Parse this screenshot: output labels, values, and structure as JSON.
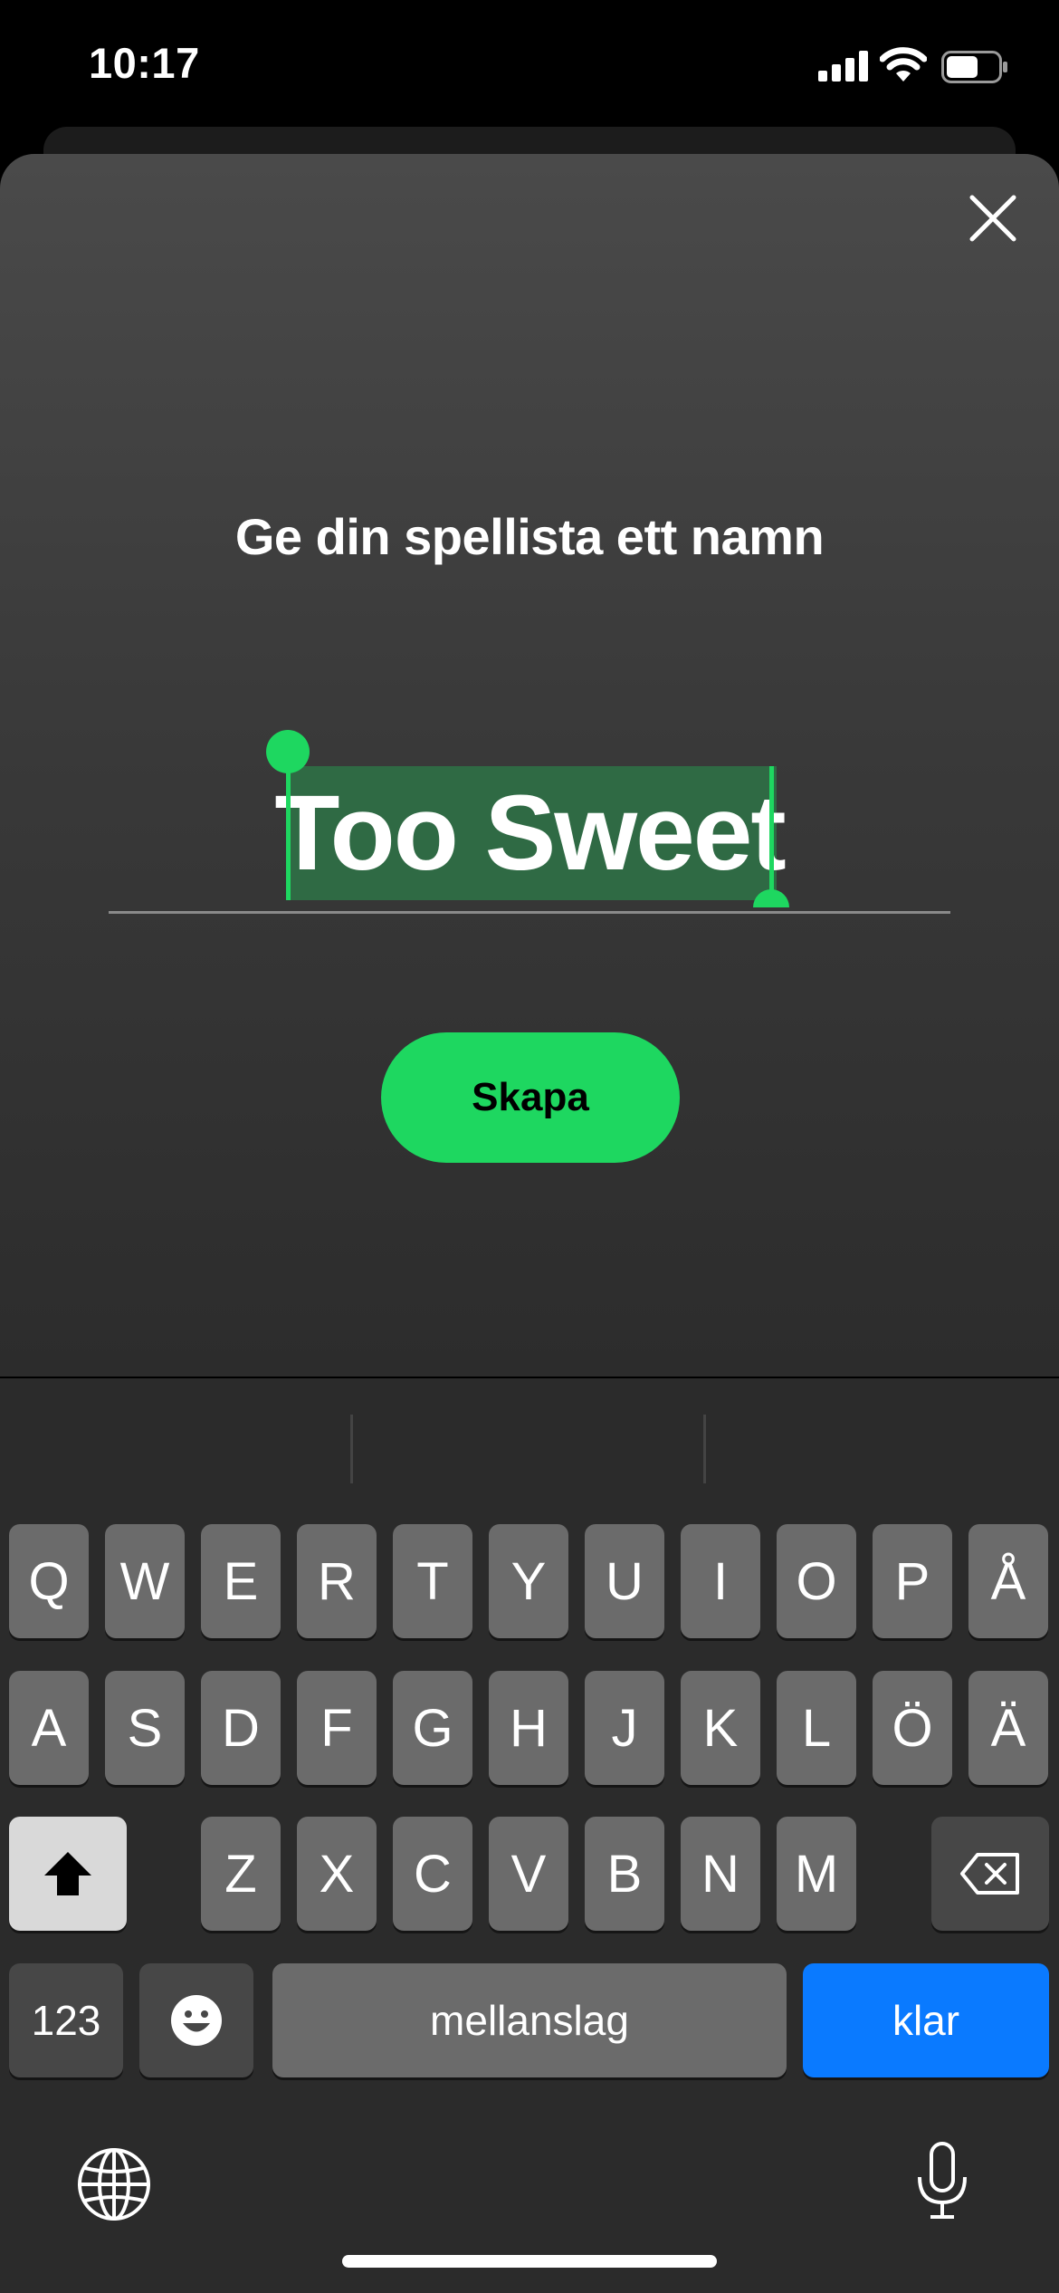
{
  "status_bar": {
    "time": "10:17"
  },
  "dialog": {
    "title": "Ge din spellista ett namn",
    "playlist_name": "Too Sweet",
    "create_label": "Skapa",
    "accent": "#1ed760"
  },
  "keyboard": {
    "row1": [
      "Q",
      "W",
      "E",
      "R",
      "T",
      "Y",
      "U",
      "I",
      "O",
      "P",
      "Å"
    ],
    "row2": [
      "A",
      "S",
      "D",
      "F",
      "G",
      "H",
      "J",
      "K",
      "L",
      "Ö",
      "Ä"
    ],
    "row3": [
      "Z",
      "X",
      "C",
      "V",
      "B",
      "N",
      "M"
    ],
    "numbers_label": "123",
    "space_label": "mellanslag",
    "return_label": "klar",
    "return_color": "#0a7aff"
  }
}
